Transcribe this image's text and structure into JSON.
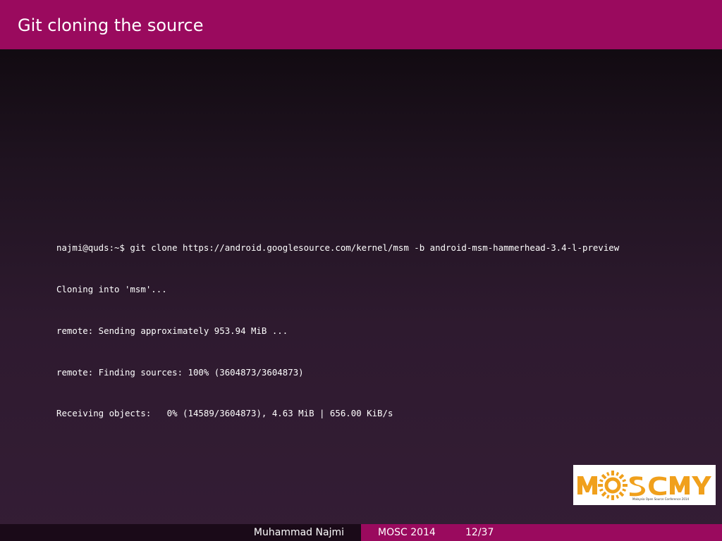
{
  "slide": {
    "title": "Git cloning the source"
  },
  "terminal": {
    "lines": [
      "najmi@quds:~$ git clone https://android.googlesource.com/kernel/msm -b android-msm-hammerhead-3.4-l-preview",
      "Cloning into 'msm'...",
      "remote: Sending approximately 953.94 MiB ...",
      "remote: Finding sources: 100% (3604873/3604873)",
      "Receiving objects:   0% (14589/3604873), 4.63 MiB | 656.00 KiB/s"
    ]
  },
  "logo": {
    "text": "MOSCMY",
    "tagline": "Malaysia Open Source Conference 2014",
    "colors": {
      "primary": "#f0a01c",
      "secondary": "#e07b10"
    }
  },
  "footer": {
    "author": "Muhammad Najmi",
    "conference": "MOSC 2014",
    "page": "12/37"
  },
  "colors": {
    "accent": "#9a0a5e",
    "footer_dark": "#1a0a18",
    "text": "#ffffff"
  }
}
